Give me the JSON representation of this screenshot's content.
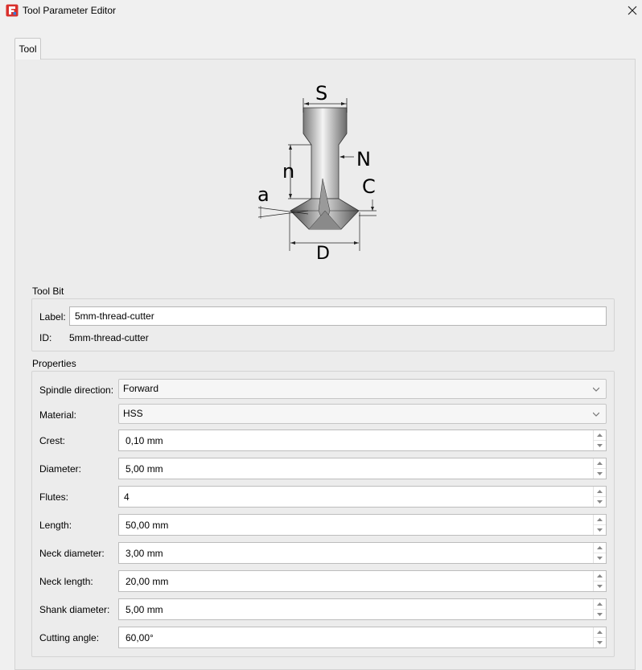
{
  "window": {
    "title": "Tool Parameter Editor"
  },
  "tabs": [
    {
      "label": "Tool"
    }
  ],
  "diagram": {
    "labels": {
      "S": "S",
      "n": "n",
      "N": "N",
      "a": "a",
      "C": "C",
      "D": "D"
    }
  },
  "tool_bit": {
    "group_title": "Tool Bit",
    "label_caption": "Label:",
    "label_value": "5mm-thread-cutter",
    "id_caption": "ID:",
    "id_value": "5mm-thread-cutter"
  },
  "properties": {
    "group_title": "Properties",
    "spindle_direction": {
      "caption": "Spindle direction:",
      "value": "Forward"
    },
    "material": {
      "caption": "Material:",
      "value": "HSS"
    },
    "fields": [
      {
        "caption": "Crest:",
        "value": "0,10 mm"
      },
      {
        "caption": "Diameter:",
        "value": "5,00 mm"
      },
      {
        "caption": "Flutes:",
        "value": "4"
      },
      {
        "caption": "Length:",
        "value": "50,00 mm"
      },
      {
        "caption": "Neck diameter:",
        "value": "3,00 mm"
      },
      {
        "caption": "Neck length:",
        "value": "20,00 mm"
      },
      {
        "caption": "Shank diameter:",
        "value": "5,00 mm"
      },
      {
        "caption": "Cutting angle:",
        "value": "60,00°"
      }
    ]
  },
  "colors": {
    "app_icon": "#d9302c",
    "background": "#f0f0f0",
    "pane": "#ececec"
  },
  "icons": {
    "app": "freecad-app-icon",
    "close": "close-icon",
    "combo_arrow": "chevron-down-icon",
    "spin_up": "spin-up-icon",
    "spin_down": "spin-down-icon"
  }
}
